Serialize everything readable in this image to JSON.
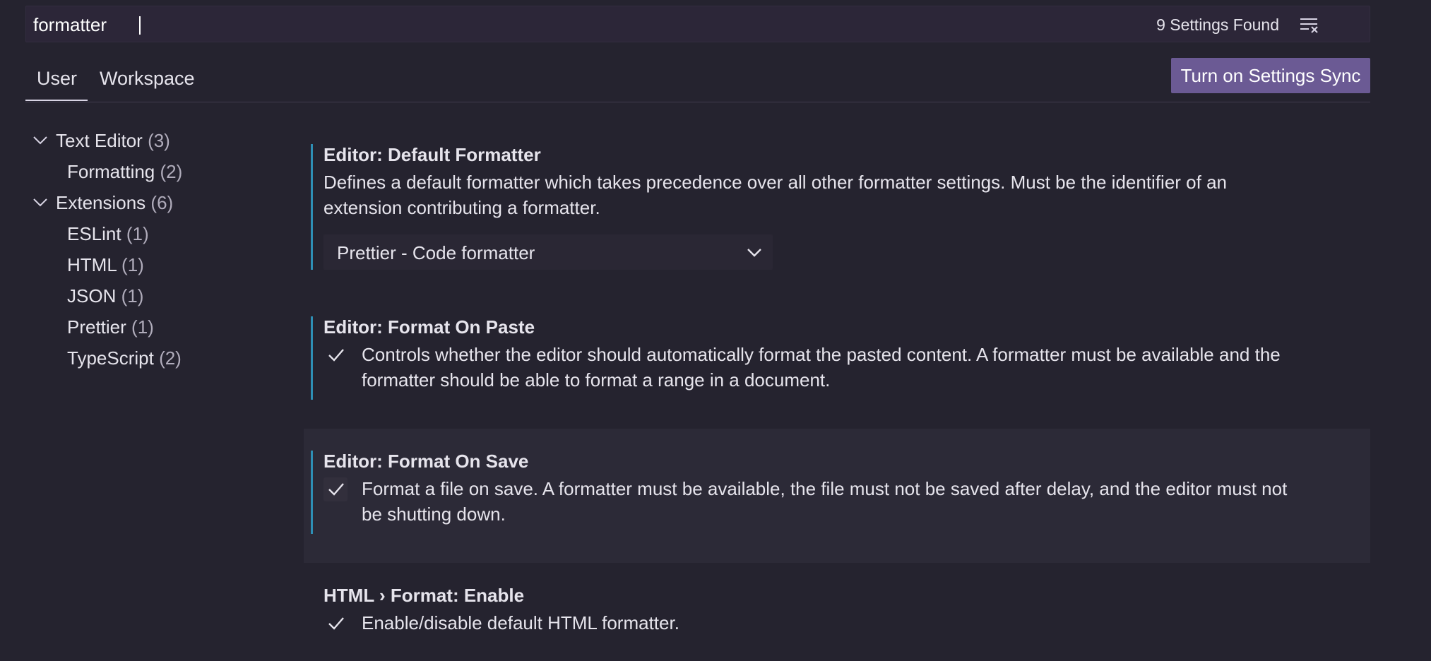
{
  "search": {
    "value": "formatter",
    "results_label": "9 Settings Found",
    "clear_icon": "clear-filter-icon"
  },
  "tabs": [
    {
      "label": "User",
      "active": true
    },
    {
      "label": "Workspace",
      "active": false
    }
  ],
  "sync_button": {
    "label": "Turn on Settings Sync"
  },
  "toc": [
    {
      "label": "Text Editor",
      "count": "(3)",
      "expanded": true,
      "level": 0
    },
    {
      "label": "Formatting",
      "count": "(2)",
      "level": 1
    },
    {
      "label": "Extensions",
      "count": "(6)",
      "expanded": true,
      "level": 0
    },
    {
      "label": "ESLint",
      "count": "(1)",
      "level": 1
    },
    {
      "label": "HTML",
      "count": "(1)",
      "level": 1
    },
    {
      "label": "JSON",
      "count": "(1)",
      "level": 1
    },
    {
      "label": "Prettier",
      "count": "(1)",
      "level": 1
    },
    {
      "label": "TypeScript",
      "count": "(2)",
      "level": 1
    }
  ],
  "settings": {
    "default_formatter": {
      "title": "Editor: Default Formatter",
      "description_line1": "Defines a default formatter which takes precedence over all other formatter settings. Must be the identifier of an",
      "description_line2": "extension contributing a formatter.",
      "value": "Prettier - Code formatter"
    },
    "format_on_paste": {
      "title": "Editor: Format On Paste",
      "description_line1": "Controls whether the editor should automatically format the pasted content. A formatter must be available and the",
      "description_line2": "formatter should be able to format a range in a document.",
      "checked": true
    },
    "format_on_save": {
      "title": "Editor: Format On Save",
      "description_line1": "Format a file on save. A formatter must be available, the file must not be saved after delay, and the editor must not",
      "description_line2": "be shutting down.",
      "checked": true
    },
    "html_format_enable": {
      "title": "HTML › Format: Enable",
      "description_line1": "Enable/disable default HTML formatter.",
      "checked": true
    }
  },
  "colors": {
    "background": "#25232f",
    "accent_bar": "#2e8fb5",
    "sync_button": "#6b5a94"
  }
}
